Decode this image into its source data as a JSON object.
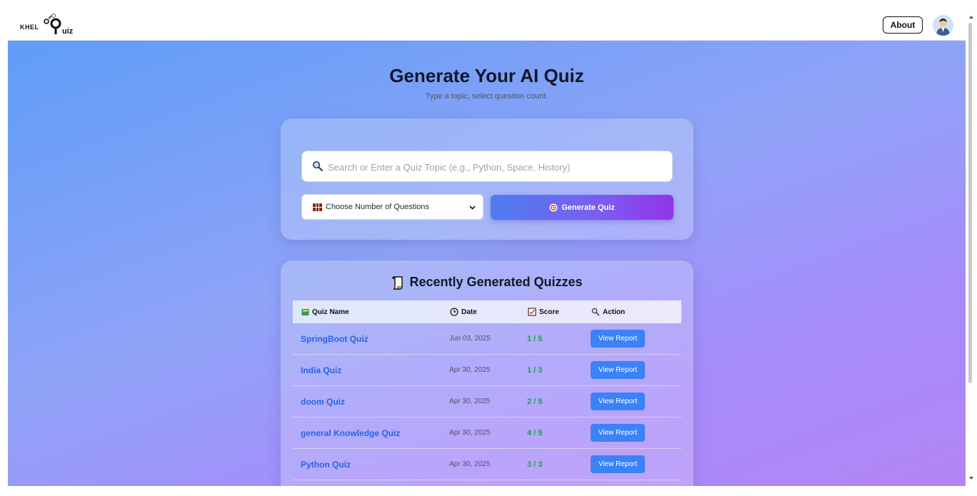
{
  "brand": {
    "prefix": "KHEL",
    "suffix": "uiz"
  },
  "nav": {
    "about_label": "About"
  },
  "hero": {
    "title": "Generate Your AI Quiz",
    "subtitle": "Type a topic, select question count."
  },
  "form": {
    "search_placeholder": "Search or Enter a Quiz Topic (e.g., Python, Space, History)",
    "search_value": "",
    "select_label": "Choose Number of Questions",
    "generate_label": "Generate Quiz"
  },
  "recent": {
    "title": "Recently Generated Quizzes",
    "columns": {
      "name": "Quiz Name",
      "date": "Date",
      "score": "Score",
      "action": "Action"
    },
    "rows": [
      {
        "name": "SpringBoot Quiz",
        "date": "Jun 03, 2025",
        "score": "1 / 5",
        "action": "View Report"
      },
      {
        "name": "India Quiz",
        "date": "Apr 30, 2025",
        "score": "1 / 3",
        "action": "View Report"
      },
      {
        "name": "doom Quiz",
        "date": "Apr 30, 2025",
        "score": "2 / 5",
        "action": "View Report"
      },
      {
        "name": "general Knowledge Quiz",
        "date": "Apr 30, 2025",
        "score": "4 / 5",
        "action": "View Report"
      },
      {
        "name": "Python Quiz",
        "date": "Apr 30, 2025",
        "score": "3 / 3",
        "action": "View Report"
      }
    ]
  },
  "colors": {
    "gradient_start": "#5f9df7",
    "gradient_end": "#b286f4",
    "link": "#2563eb",
    "score": "#16a34a",
    "button": "#3b82f6"
  },
  "icons": {
    "search": "magnifier-icon",
    "select": "grid-icon",
    "generate": "target-icon",
    "title": "scroll-icon",
    "name_col": "book-icon",
    "date_col": "clock-icon",
    "score_col": "checkbox-icon",
    "action_col": "magnifier-icon"
  }
}
